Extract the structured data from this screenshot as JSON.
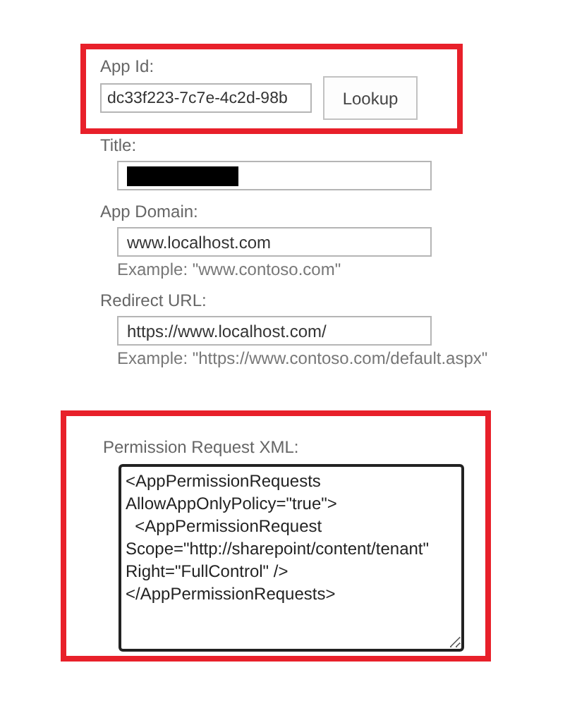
{
  "app_id": {
    "label": "App Id:",
    "value": "dc33f223-7c7e-4c2d-98b",
    "button": "Lookup"
  },
  "title": {
    "label": "Title:"
  },
  "app_domain": {
    "label": "App Domain:",
    "value": "www.localhost.com",
    "example": "Example: \"www.contoso.com\""
  },
  "redirect_url": {
    "label": "Redirect URL:",
    "value": "https://www.localhost.com/",
    "example": "Example: \"https://www.contoso.com/default.aspx\""
  },
  "permission_request_xml": {
    "label": "Permission Request XML:",
    "value": "<AppPermissionRequests\nAllowAppOnlyPolicy=\"true\">\n  <AppPermissionRequest\nScope=\"http://sharepoint/content/tenant\"\nRight=\"FullControl\" />\n</AppPermissionRequests>"
  }
}
